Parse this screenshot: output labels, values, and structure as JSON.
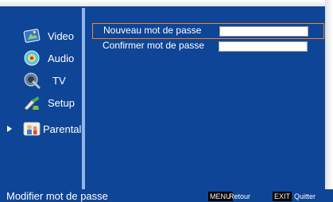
{
  "menu": {
    "items": [
      {
        "label": "Video",
        "icon": "video-icon"
      },
      {
        "label": "Audio",
        "icon": "audio-icon"
      },
      {
        "label": "TV",
        "icon": "tv-icon"
      },
      {
        "label": "Setup",
        "icon": "setup-icon"
      },
      {
        "label": "Parental",
        "icon": "parental-icon",
        "selected": true
      }
    ]
  },
  "form": {
    "new_password_label": "Nouveau mot de passe",
    "new_password_value": "",
    "confirm_password_label": "Confirmer mot de passe",
    "confirm_password_value": ""
  },
  "footer": {
    "hint": "Modifier mot de passe",
    "menu_key": "MENU",
    "menu_action": "Retour",
    "exit_key": "EXIT",
    "exit_action": "Quitter"
  },
  "colors": {
    "background": "#0f4596",
    "divider": "#8fb6e8",
    "selection_border": "#f0862a"
  }
}
